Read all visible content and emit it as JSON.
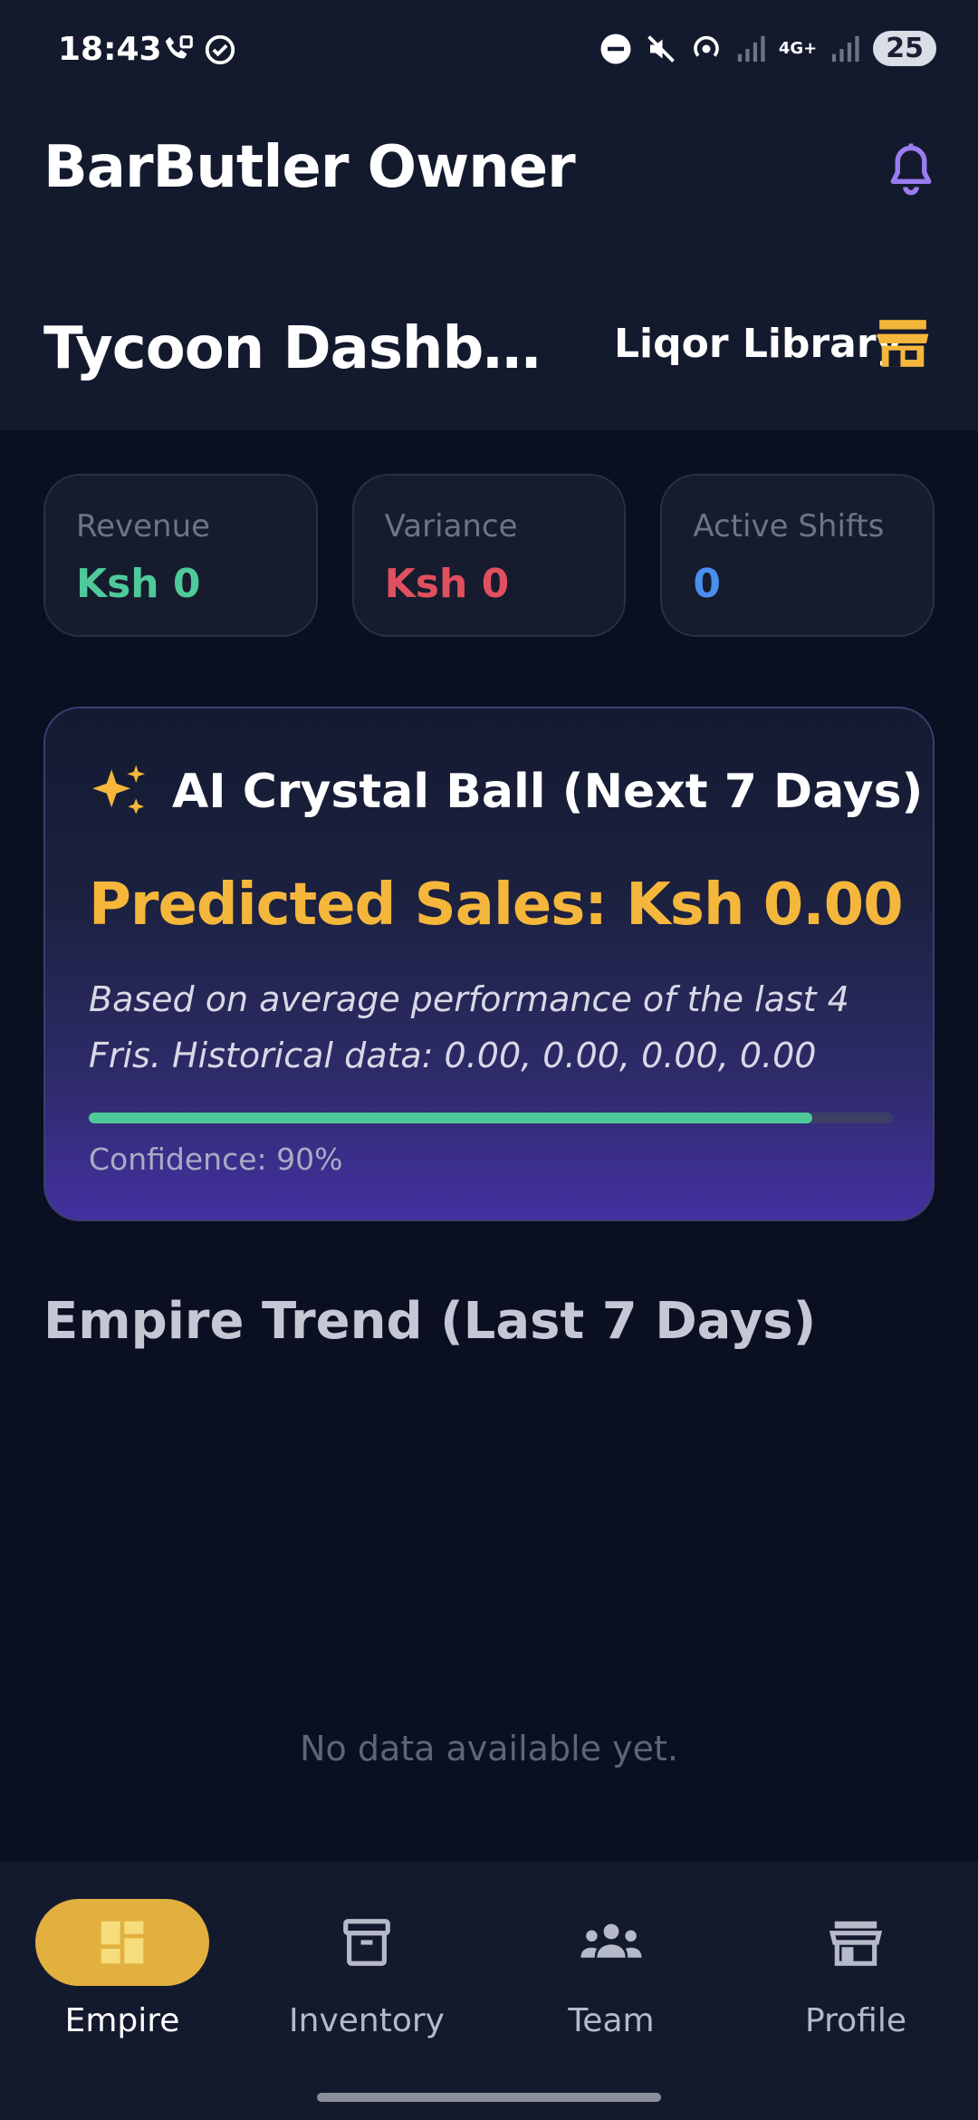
{
  "status_bar": {
    "time": "18:43",
    "battery": "25",
    "network": "4G+"
  },
  "header": {
    "app_title": "BarButler Owner",
    "page_title": "Tycoon Dashboard",
    "bar_name": "Liqor Library"
  },
  "stats": [
    {
      "label": "Revenue",
      "value": "Ksh 0",
      "color": "#4fc99a"
    },
    {
      "label": "Variance",
      "value": "Ksh 0",
      "color": "#e0505f"
    },
    {
      "label": "Active Shifts",
      "value": "0",
      "color": "#4a8ff0"
    }
  ],
  "ai_card": {
    "title": "AI Crystal Ball (Next 7 Days)",
    "prediction": "Predicted Sales: Ksh 0.00",
    "description": "Based on average performance of the last 4 Fris. Historical data: 0.00, 0.00, 0.00, 0.00",
    "confidence_label": "Confidence: 90%",
    "confidence": 0.9
  },
  "trend": {
    "title": "Empire Trend (Last 7 Days)",
    "empty_text": "No data available yet."
  },
  "nav": [
    {
      "label": "Empire",
      "icon": "dashboard-icon",
      "active": true
    },
    {
      "label": "Inventory",
      "icon": "archive-icon",
      "active": false
    },
    {
      "label": "Team",
      "icon": "team-icon",
      "active": false
    },
    {
      "label": "Profile",
      "icon": "store-icon",
      "active": false
    }
  ],
  "colors": {
    "accent": "#e1b03f",
    "prediction": "#f5b73b",
    "bell": "#9a7cf0"
  }
}
